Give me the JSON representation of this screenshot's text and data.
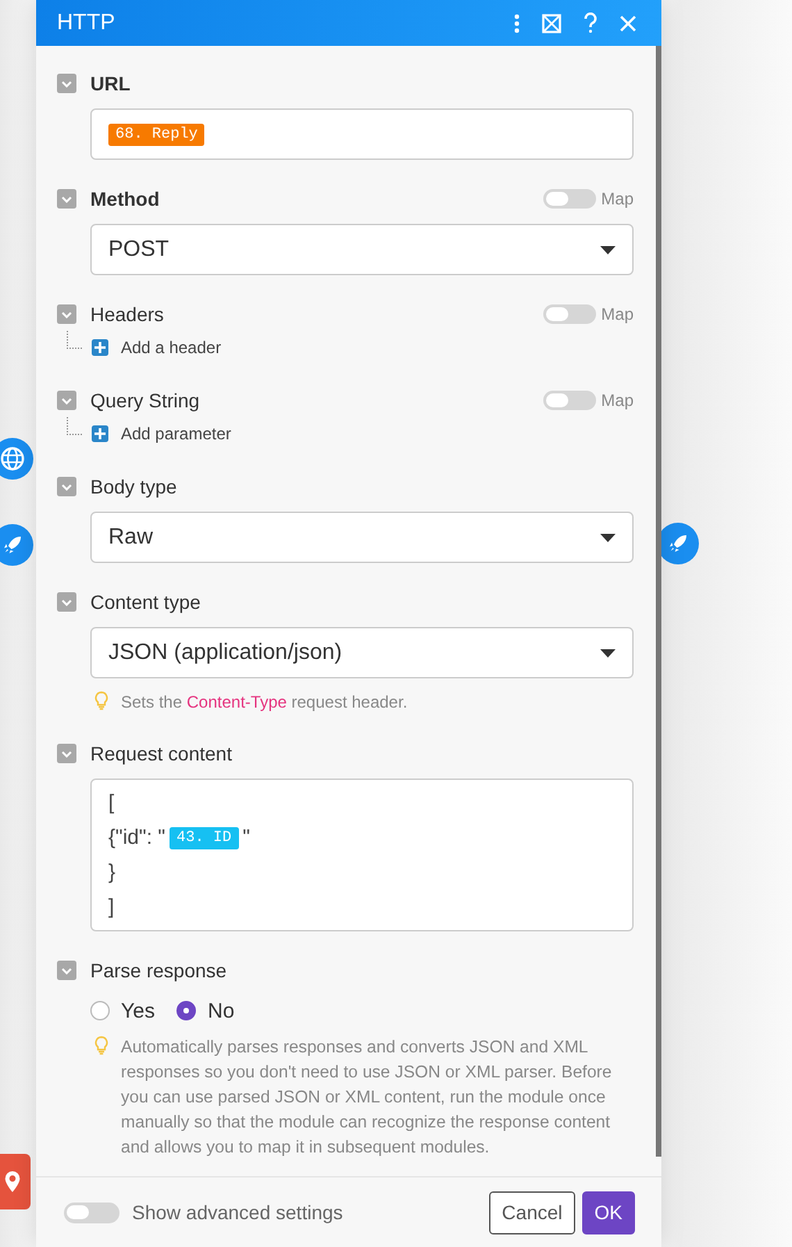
{
  "window": {
    "title": "HTTP"
  },
  "sections": [
    {
      "kind": "pill-field",
      "label": "URL",
      "bold": true,
      "pill": {
        "text": "68. Reply",
        "color": "#f77a00"
      }
    },
    {
      "kind": "select",
      "label": "Method",
      "bold": true,
      "map": {
        "label": "Map",
        "on": false
      },
      "value": "POST"
    },
    {
      "kind": "add",
      "label": "Headers",
      "bold": false,
      "map": {
        "label": "Map",
        "on": false
      },
      "action": "Add a header"
    },
    {
      "kind": "add",
      "label": "Query String",
      "bold": false,
      "map": {
        "label": "Map",
        "on": false
      },
      "action": "Add parameter"
    },
    {
      "kind": "select",
      "label": "Body type",
      "bold": false,
      "value": "Raw"
    },
    {
      "kind": "select",
      "label": "Content type",
      "bold": false,
      "value": "JSON (application/json)",
      "hint": {
        "before": "Sets the ",
        "link": "Content-Type",
        "after": " request header."
      }
    },
    {
      "kind": "code",
      "label": "Request content",
      "bold": false,
      "lines": [
        {
          "text": "["
        },
        {
          "text": "{\"id\": \"",
          "pill": {
            "text": "43. ID",
            "color": "#16c0f2"
          },
          "after": "\""
        },
        {
          "text": "}"
        },
        {
          "text": "]"
        }
      ]
    },
    {
      "kind": "radio",
      "label": "Parse response",
      "bold": false,
      "options": [
        {
          "label": "Yes",
          "selected": false
        },
        {
          "label": "No",
          "selected": true
        }
      ],
      "hint": {
        "before": "Automatically parses responses and converts JSON and XML responses so you don't need to use JSON or XML parser. Before you can use parsed JSON or XML content, run the module once manually so that the module can recognize the response content and allows you to map it in subsequent modules."
      }
    }
  ],
  "footer": {
    "advanced": {
      "label": "Show advanced settings",
      "on": false
    },
    "buttons": [
      {
        "label": "Cancel",
        "kind": "secondary"
      },
      {
        "label": "OK",
        "kind": "primary"
      }
    ]
  }
}
